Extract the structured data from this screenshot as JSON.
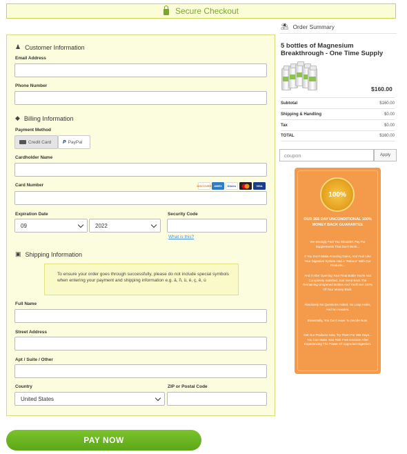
{
  "banner": {
    "text": "Secure Checkout"
  },
  "customer": {
    "title": "Customer Information",
    "email_label": "Email Address",
    "email_value": "",
    "phone_label": "Phone Number",
    "phone_value": ""
  },
  "billing": {
    "title": "Billing Information",
    "payment_method_label": "Payment Method",
    "methods": [
      "Credit Card",
      "PayPal"
    ],
    "cardholder_label": "Cardholder Name",
    "card_number_label": "Card Number",
    "card_brands": [
      "DISCOVER",
      "AMEX",
      "Diners",
      "MC",
      "VISA"
    ],
    "expiration_label": "Expiration Date",
    "exp_month": "09",
    "exp_year": "2022",
    "security_label": "Security Code",
    "what_is_this": "What is this?"
  },
  "shipping": {
    "title": "Shipping Information",
    "notice": "To ensure your order goes through successfully, please do not include special symbols when entering your payment and shipping information e.g. ä, ñ, ü, é, ç, ê, ú",
    "full_name_label": "Full Name",
    "street_label": "Street Address",
    "apt_label": "Apt / Suite / Other",
    "country_label": "Country",
    "country_value": "United States",
    "zip_label": "ZIP or Postal Code"
  },
  "pay_button": "PAY NOW",
  "summary": {
    "title": "Order Summary",
    "product": "5 bottles of Magnesium Breakthrough - One Time Supply",
    "price": "$160.00",
    "rows": [
      {
        "k": "Subtotal",
        "v": "$160.00"
      },
      {
        "k": "Shipping & Handling",
        "v": "$0.00"
      },
      {
        "k": "Tax",
        "v": "$0.00"
      },
      {
        "k": "TOTAL",
        "v": "$160.00"
      }
    ],
    "coupon_placeholder": "coupon",
    "apply_label": "Apply"
  },
  "guarantee": {
    "badge": "100%",
    "title": "OUR 365 DAY UNCONDITIONAL 100% MONEY BACK GUARANTEE",
    "paragraphs": [
      "We Strongly Feel You Shouldn't Pay For Supplements That Don't Work...",
      "If You Don't Make Amazing Gains, And Feel Like Your Digestive System Had A \"Reboot\" With Our Products...",
      "And If After Opening Your Final Bottle You're Not Completely Satisfied, Just Send Back The Remaining Unopened Bottles And You'll Get 100% Of Your Money Back.",
      "Absolutely No Questions Asked, No Loop Holes, And No Hassles.",
      "Essentially, You Don't Have To Decide Now.",
      "Get Our Products Now, Try Them For 365 Days... You Can Make Your Risk Free Decision After Experiencing The Power Of Upgraded Digestion."
    ]
  },
  "colors": {
    "accent": "#7aa62c",
    "pay_green": "#6cb522",
    "guarantee_orange": "#f39b4a",
    "form_bg": "#fcfddf"
  }
}
